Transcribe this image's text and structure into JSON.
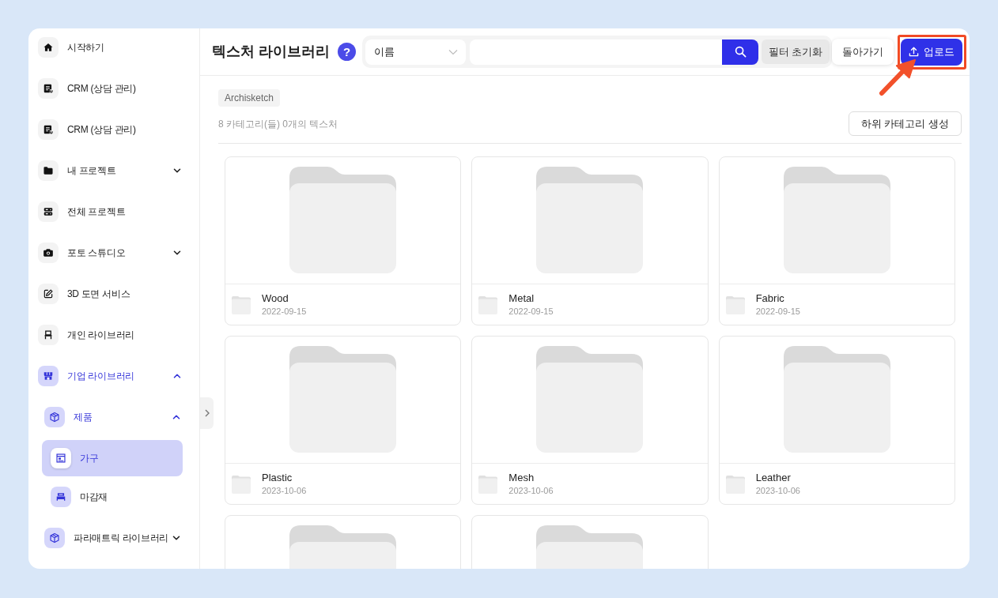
{
  "sidebar": {
    "items": [
      {
        "label": "시작하기",
        "selected": false
      },
      {
        "label": "CRM (상담 관리)",
        "selected": false
      },
      {
        "label": "CRM (상담 관리)",
        "selected": false
      },
      {
        "label": "내 프로젝트",
        "selected": false,
        "expanded": false
      },
      {
        "label": "전체 프로젝트",
        "selected": false
      },
      {
        "label": "포토 스튜디오",
        "selected": false,
        "expanded": false
      },
      {
        "label": "3D 도면 서비스",
        "selected": false
      },
      {
        "label": "개인 라이브러리",
        "selected": false
      },
      {
        "label": "기업 라이브러리",
        "selected": false,
        "expanded": true,
        "children": [
          {
            "label": "제품",
            "selected": false,
            "expanded": true,
            "children": [
              {
                "label": "가구",
                "selected": true
              },
              {
                "label": "마감재",
                "selected": false
              }
            ]
          },
          {
            "label": "파라매트릭 라이브러리",
            "selected": false,
            "expanded": false
          }
        ]
      }
    ]
  },
  "header": {
    "title": "텍스처 라이브러리",
    "help_button": "?",
    "filter": {
      "field": "이름"
    },
    "reset_button": "필터 초기화",
    "actions": [
      {
        "label": "돌아가기",
        "kind": "secondary",
        "highlighted": false
      },
      {
        "label": "업로드",
        "kind": "primary",
        "highlighted": true
      }
    ]
  },
  "content": {
    "breadcrumb": [
      "Archisketch"
    ],
    "summary": "8 카테고리(들) 0개의 텍스처",
    "create_button": "하위 카테고리 생성",
    "folders": [
      {
        "kind": "folder",
        "name": "Wood",
        "date": "2022-09-15"
      },
      {
        "kind": "folder",
        "name": "Metal",
        "date": "2022-09-15"
      },
      {
        "kind": "folder",
        "name": "Fabric",
        "date": "2022-09-15"
      },
      {
        "kind": "folder",
        "name": "Plastic",
        "date": "2023-10-06"
      },
      {
        "kind": "folder",
        "name": "Mesh",
        "date": "2023-10-06"
      },
      {
        "kind": "folder",
        "name": "Leather",
        "date": "2023-10-06"
      },
      {
        "kind": "folder"
      },
      {
        "kind": "folder"
      }
    ]
  }
}
